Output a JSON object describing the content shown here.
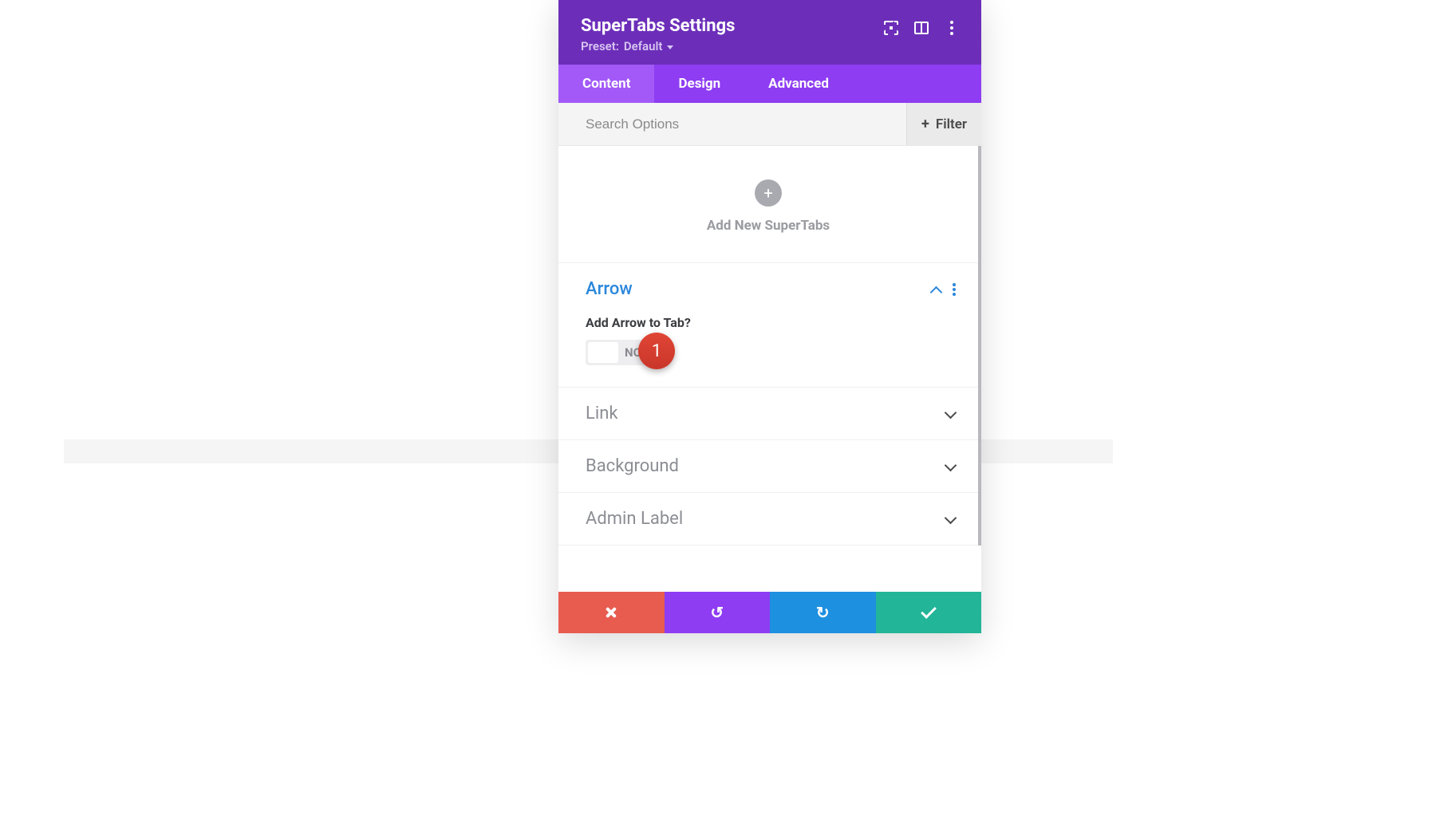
{
  "header": {
    "title": "SuperTabs Settings",
    "preset_prefix": "Preset: ",
    "preset_value": "Default"
  },
  "tabs": [
    {
      "label": "Content",
      "active": true
    },
    {
      "label": "Design",
      "active": false
    },
    {
      "label": "Advanced",
      "active": false
    }
  ],
  "search": {
    "placeholder": "Search Options",
    "filter_label": "Filter"
  },
  "add": {
    "label": "Add New SuperTabs",
    "callout_number": "1"
  },
  "sections": {
    "arrow": {
      "title": "Arrow",
      "expanded": true,
      "field_label": "Add Arrow to Tab?",
      "toggle_value": "NO"
    },
    "link": {
      "title": "Link",
      "expanded": false
    },
    "background": {
      "title": "Background",
      "expanded": false
    },
    "admin_label": {
      "title": "Admin Label",
      "expanded": false
    }
  },
  "colors": {
    "header_bg": "#6c2eb9",
    "tabs_bg": "#8e3df2",
    "tab_active_bg": "#a259f7",
    "accent_blue": "#2b87da",
    "cancel": "#e85c50",
    "undo": "#8e3df2",
    "redo": "#1e90e0",
    "save": "#22b598",
    "callout": "#d83a2a"
  }
}
